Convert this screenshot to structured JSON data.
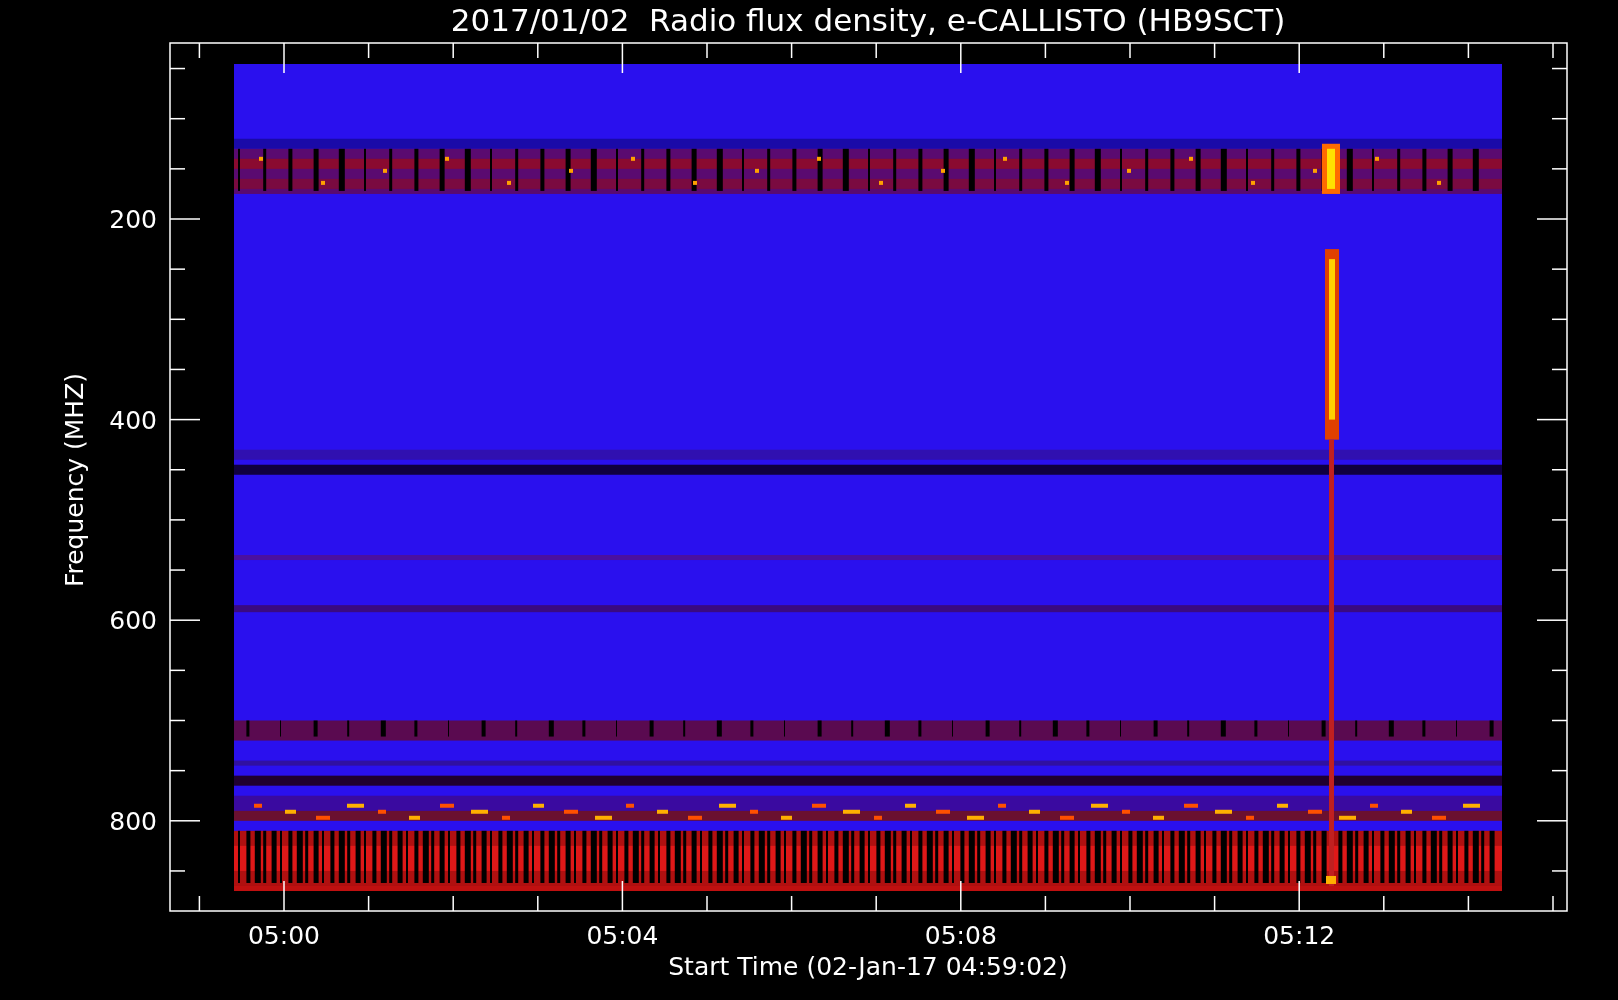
{
  "plot": {
    "title": "2017/01/02  Radio flux density, e-CALLISTO (HB9SCT)",
    "ylabel": "Frequency (MHZ)",
    "xlabel": "Start Time (02-Jan-17 04:59:02)",
    "y_tick_labels": [
      "200",
      "400",
      "600",
      "800"
    ],
    "x_tick_labels": [
      "05:00",
      "05:04",
      "05:08",
      "05:12"
    ]
  }
}
